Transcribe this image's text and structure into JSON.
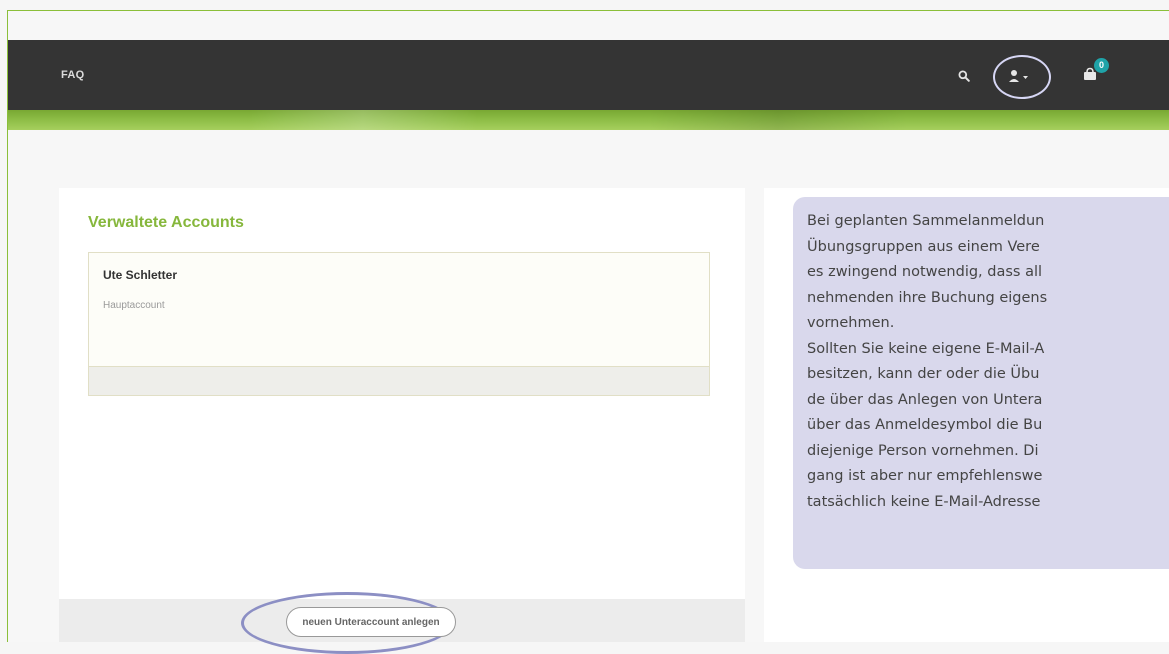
{
  "nav": {
    "faq_label": "FAQ",
    "cart_count": "0",
    "icons": [
      "search-icon",
      "user-icon",
      "shopping-bag-icon"
    ]
  },
  "accounts": {
    "title": "Verwaltete Accounts",
    "items": [
      {
        "name": "Ute Schletter",
        "role": "Hauptaccount"
      }
    ],
    "new_account_button": "neuen Unteraccount anlegen"
  },
  "info": {
    "lines": [
      "Bei geplanten Sammelanmeldun",
      "Übungsgruppen aus einem Vere",
      "es zwingend notwendig, dass all",
      "nehmenden ihre Buchung eigens",
      "vornehmen.",
      "Sollten Sie keine eigene E-Mail-A",
      "besitzen, kann der oder die  Übu",
      "de über das Anlegen von Untera",
      "über das Anmeldesymbol die Bu",
      "diejenige Person vornehmen. Di",
      "gang ist aber nur empfehlenswe",
      "tatsächlich keine E-Mail-Adresse"
    ]
  },
  "colors": {
    "accent_green": "#86b73c",
    "nav_dark": "#343434",
    "badge_teal": "#1fa3a8",
    "highlight_purple": "#8c8fc4",
    "info_background": "#d9d8ec"
  }
}
